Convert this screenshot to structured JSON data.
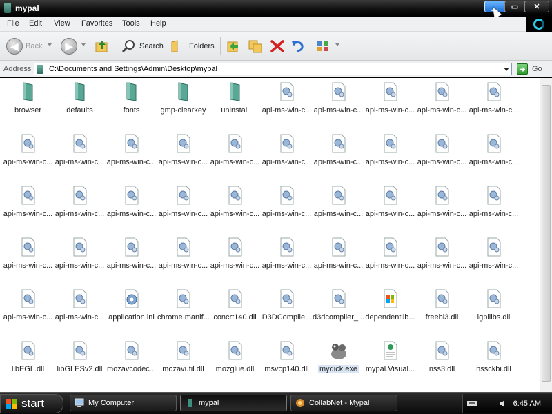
{
  "window": {
    "title": "mypal"
  },
  "menu": [
    "File",
    "Edit",
    "View",
    "Favorites",
    "Tools",
    "Help"
  ],
  "toolbar": {
    "back_label": "Back",
    "search_label": "Search",
    "folders_label": "Folders"
  },
  "address": {
    "label": "Address",
    "path": "C:\\Documents and Settings\\Admin\\Desktop\\mypal",
    "go_label": "Go"
  },
  "files": [
    {
      "name": "browser",
      "type": "folder"
    },
    {
      "name": "defaults",
      "type": "folder"
    },
    {
      "name": "fonts",
      "type": "folder"
    },
    {
      "name": "gmp-clearkey",
      "type": "folder"
    },
    {
      "name": "uninstall",
      "type": "folder"
    },
    {
      "name": "api-ms-win-c...",
      "type": "dll"
    },
    {
      "name": "api-ms-win-c...",
      "type": "dll"
    },
    {
      "name": "api-ms-win-c...",
      "type": "dll"
    },
    {
      "name": "api-ms-win-c...",
      "type": "dll"
    },
    {
      "name": "api-ms-win-c...",
      "type": "dll"
    },
    {
      "name": "api-ms-win-c...",
      "type": "dll"
    },
    {
      "name": "api-ms-win-c...",
      "type": "dll"
    },
    {
      "name": "api-ms-win-c...",
      "type": "dll"
    },
    {
      "name": "api-ms-win-c...",
      "type": "dll"
    },
    {
      "name": "api-ms-win-c...",
      "type": "dll"
    },
    {
      "name": "api-ms-win-c...",
      "type": "dll"
    },
    {
      "name": "api-ms-win-c...",
      "type": "dll"
    },
    {
      "name": "api-ms-win-c...",
      "type": "dll"
    },
    {
      "name": "api-ms-win-c...",
      "type": "dll"
    },
    {
      "name": "api-ms-win-c...",
      "type": "dll"
    },
    {
      "name": "api-ms-win-c...",
      "type": "dll"
    },
    {
      "name": "api-ms-win-c...",
      "type": "dll"
    },
    {
      "name": "api-ms-win-c...",
      "type": "dll"
    },
    {
      "name": "api-ms-win-c...",
      "type": "dll"
    },
    {
      "name": "api-ms-win-c...",
      "type": "dll"
    },
    {
      "name": "api-ms-win-c...",
      "type": "dll"
    },
    {
      "name": "api-ms-win-c...",
      "type": "dll"
    },
    {
      "name": "api-ms-win-c...",
      "type": "dll"
    },
    {
      "name": "api-ms-win-c...",
      "type": "dll"
    },
    {
      "name": "api-ms-win-c...",
      "type": "dll"
    },
    {
      "name": "api-ms-win-c...",
      "type": "dll"
    },
    {
      "name": "api-ms-win-c...",
      "type": "dll"
    },
    {
      "name": "api-ms-win-c...",
      "type": "dll"
    },
    {
      "name": "api-ms-win-c...",
      "type": "dll"
    },
    {
      "name": "api-ms-win-c...",
      "type": "dll"
    },
    {
      "name": "api-ms-win-c...",
      "type": "dll"
    },
    {
      "name": "api-ms-win-c...",
      "type": "dll"
    },
    {
      "name": "api-ms-win-c...",
      "type": "dll"
    },
    {
      "name": "api-ms-win-c...",
      "type": "dll"
    },
    {
      "name": "api-ms-win-c...",
      "type": "dll"
    },
    {
      "name": "api-ms-win-c...",
      "type": "dll"
    },
    {
      "name": "api-ms-win-c...",
      "type": "dll"
    },
    {
      "name": "application.ini",
      "type": "ini"
    },
    {
      "name": "chrome.manif...",
      "type": "dll"
    },
    {
      "name": "concrt140.dll",
      "type": "dll"
    },
    {
      "name": "D3DCompile...",
      "type": "dll"
    },
    {
      "name": "d3dcompiler_...",
      "type": "dll"
    },
    {
      "name": "dependentlib...",
      "type": "list"
    },
    {
      "name": "freebl3.dll",
      "type": "dll"
    },
    {
      "name": "lgpllibs.dll",
      "type": "dll"
    },
    {
      "name": "libEGL.dll",
      "type": "dll"
    },
    {
      "name": "libGLESv2.dll",
      "type": "dll"
    },
    {
      "name": "mozavcodec...",
      "type": "dll"
    },
    {
      "name": "mozavutil.dll",
      "type": "dll"
    },
    {
      "name": "mozglue.dll",
      "type": "dll"
    },
    {
      "name": "msvcp140.dll",
      "type": "dll"
    },
    {
      "name": "mydick.exe",
      "type": "exe",
      "selected": true
    },
    {
      "name": "mypal.Visual...",
      "type": "manifest"
    },
    {
      "name": "nss3.dll",
      "type": "dll"
    },
    {
      "name": "nssckbi.dll",
      "type": "dll"
    }
  ],
  "taskbar": {
    "start_label": "start",
    "tasks": [
      {
        "label": "My Computer"
      },
      {
        "label": "mypal"
      },
      {
        "label": "CollabNet - Mypal"
      }
    ],
    "clock": "6:45 AM"
  }
}
